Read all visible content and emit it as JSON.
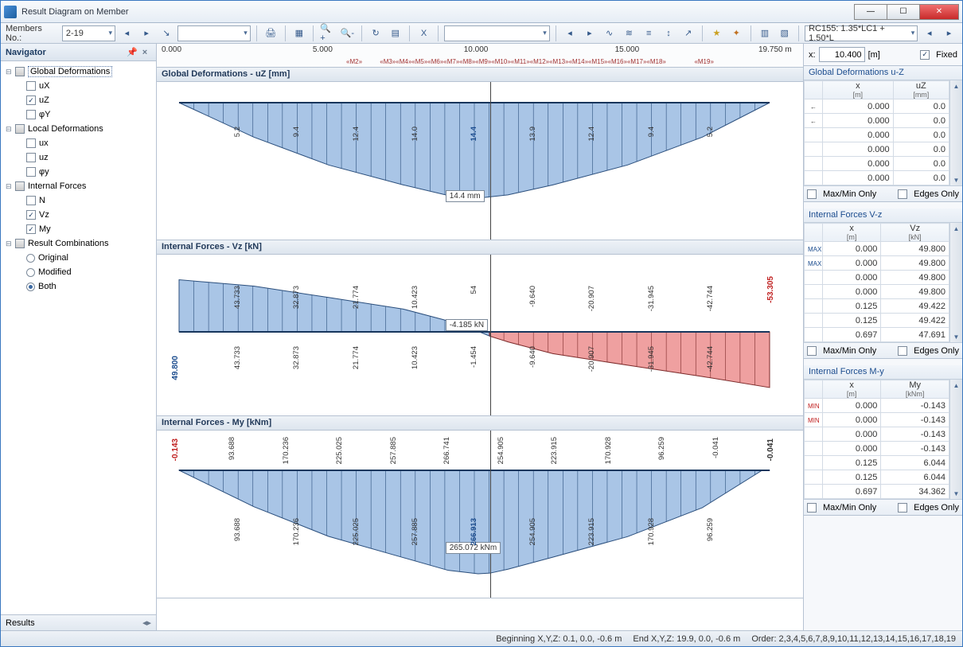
{
  "window": {
    "title": "Result Diagram on Member"
  },
  "toolbar": {
    "members_label": "Members No.:",
    "members_value": "2-19",
    "combo_case": "RC155: 1.35*LC1 + 1.50*L"
  },
  "navigator": {
    "title": "Navigator",
    "groups": [
      {
        "label": "Global Deformations",
        "items": [
          {
            "key": "uX",
            "label": "uX",
            "checked": false
          },
          {
            "key": "uZ",
            "label": "uZ",
            "checked": true
          },
          {
            "key": "phiY",
            "label": "φY",
            "checked": false
          }
        ]
      },
      {
        "label": "Local Deformations",
        "items": [
          {
            "key": "ux",
            "label": "ux",
            "checked": false
          },
          {
            "key": "uz",
            "label": "uz",
            "checked": false
          },
          {
            "key": "phiy",
            "label": "φy",
            "checked": false
          }
        ]
      },
      {
        "label": "Internal Forces",
        "items": [
          {
            "key": "N",
            "label": "N",
            "checked": false
          },
          {
            "key": "Vz",
            "label": "Vz",
            "checked": true
          },
          {
            "key": "My",
            "label": "My",
            "checked": true
          }
        ]
      },
      {
        "label": "Result Combinations",
        "items": [
          {
            "key": "orig",
            "label": "Original",
            "radio": true,
            "checked": false
          },
          {
            "key": "mod",
            "label": "Modified",
            "radio": true,
            "checked": false
          },
          {
            "key": "both",
            "label": "Both",
            "radio": true,
            "checked": true
          }
        ]
      }
    ],
    "footer": "Results"
  },
  "ruler": {
    "ticks": [
      "0.000",
      "5.000",
      "10.000",
      "15.000",
      "19.750 m"
    ],
    "mseries": [
      "M2",
      "M3",
      "M4",
      "M5",
      "M6",
      "M7",
      "M8",
      "M9",
      "M10",
      "M11",
      "M12",
      "M13",
      "M14",
      "M15",
      "M16",
      "M17",
      "M18",
      "M19"
    ]
  },
  "xbox": {
    "label": "x:",
    "value": "10.400",
    "unit": "[m]",
    "fixed_label": "Fixed",
    "fixed": true
  },
  "panels": [
    {
      "title": "Global Deformations - uZ [mm]",
      "tip": "14.4 mm",
      "left_end": "",
      "right_end": "",
      "labels_top": [
        "5.2",
        "9.4",
        "12.4",
        "14.0",
        "14.4",
        "13.9",
        "12.4",
        "9.4",
        "5.2"
      ],
      "labels_top_max": "14.4"
    },
    {
      "title": "Internal Forces - Vz [kN]",
      "tip": "-4.185 kN",
      "left_end": "49.800",
      "right_end": "-53.305",
      "labels_top": [
        "43.733",
        "32.873",
        "21.774",
        "10.423",
        "54",
        "-9.640",
        "-20.907",
        "-31.945",
        "-42.744"
      ],
      "labels_bot": [
        "43.733",
        "32.873",
        "21.774",
        "10.423",
        "-1.454",
        "-9.640",
        "-20.907",
        "-31.945",
        "-42.744"
      ]
    },
    {
      "title": "Internal Forces - My [kNm]",
      "tip": "265.072 kNm",
      "left_end": "-0.143",
      "right_end": "-0.041",
      "labels_top": [
        "93.688",
        "170.236",
        "225.025",
        "257.885",
        "266.741",
        "254.905",
        "223.915",
        "170.928",
        "96.259",
        "-0.041"
      ],
      "labels_bot": [
        "93.688",
        "170.236",
        "225.025",
        "257.885",
        "266.913",
        "254.905",
        "223.915",
        "170.928",
        "96.259"
      ]
    }
  ],
  "grids": [
    {
      "title": "Global Deformations u-Z",
      "hx": "x",
      "hxu": "[m]",
      "hv": "uZ",
      "hvu": "[mm]",
      "rows": [
        {
          "mk": "←",
          "x": "0.000",
          "v": "0.0"
        },
        {
          "mk": "←",
          "x": "0.000",
          "v": "0.0"
        },
        {
          "x": "0.000",
          "v": "0.0"
        },
        {
          "x": "0.000",
          "v": "0.0"
        },
        {
          "x": "0.000",
          "v": "0.0"
        },
        {
          "x": "0.000",
          "v": "0.0"
        }
      ],
      "maxmin": "Max/Min Only",
      "edges": "Edges Only"
    },
    {
      "title": "Internal Forces V-z",
      "hx": "x",
      "hxu": "[m]",
      "hv": "Vz",
      "hvu": "[kN]",
      "rows": [
        {
          "mk": "MAX",
          "mkc": "max",
          "x": "0.000",
          "v": "49.800"
        },
        {
          "mk": "MAX",
          "mkc": "max",
          "x": "0.000",
          "v": "49.800"
        },
        {
          "x": "0.000",
          "v": "49.800"
        },
        {
          "x": "0.000",
          "v": "49.800"
        },
        {
          "x": "0.125",
          "v": "49.422"
        },
        {
          "x": "0.125",
          "v": "49.422"
        },
        {
          "x": "0.697",
          "v": "47.691"
        }
      ],
      "maxmin": "Max/Min Only",
      "edges": "Edges Only"
    },
    {
      "title": "Internal Forces M-y",
      "hx": "x",
      "hxu": "[m]",
      "hv": "My",
      "hvu": "[kNm]",
      "rows": [
        {
          "mk": "MIN",
          "mkc": "min",
          "x": "0.000",
          "v": "-0.143"
        },
        {
          "mk": "MIN",
          "mkc": "min",
          "x": "0.000",
          "v": "-0.143"
        },
        {
          "x": "0.000",
          "v": "-0.143"
        },
        {
          "x": "0.000",
          "v": "-0.143"
        },
        {
          "x": "0.125",
          "v": "6.044"
        },
        {
          "x": "0.125",
          "v": "6.044"
        },
        {
          "x": "0.697",
          "v": "34.362"
        }
      ],
      "maxmin": "Max/Min Only",
      "edges": "Edges Only"
    }
  ],
  "status": {
    "begin": "Beginning X,Y,Z:   0.1, 0.0, -0.6 m",
    "end": "End X,Y,Z:   19.9, 0.0, -0.6 m",
    "order": "Order:   2,3,4,5,6,7,8,9,10,11,12,13,14,15,16,17,18,19"
  },
  "chart_data": [
    {
      "type": "area",
      "title": "Global Deformations - uZ [mm]",
      "xlabel": "x [m]",
      "ylabel": "uZ [mm]",
      "x_range": [
        0,
        19.75
      ],
      "x": [
        0,
        2.5,
        5.0,
        7.5,
        9.0,
        10.0,
        11.0,
        12.5,
        15.0,
        17.5,
        19.75
      ],
      "values": [
        0,
        5.2,
        9.4,
        12.4,
        14.0,
        14.4,
        13.9,
        12.4,
        9.4,
        5.2,
        0
      ],
      "cursor_x": 10.4,
      "cursor_value": 14.4
    },
    {
      "type": "area",
      "title": "Internal Forces - Vz [kN]",
      "xlabel": "x [m]",
      "ylabel": "Vz [kN]",
      "x_range": [
        0,
        19.75
      ],
      "x": [
        0,
        2.5,
        5.0,
        7.5,
        9.0,
        10.0,
        10.4,
        11.0,
        12.5,
        15.0,
        17.5,
        19.75
      ],
      "values": [
        49.8,
        43.733,
        32.873,
        21.774,
        10.423,
        0.54,
        -4.185,
        -9.64,
        -20.907,
        -31.945,
        -42.744,
        -53.305
      ],
      "cursor_x": 10.4,
      "cursor_value": -4.185
    },
    {
      "type": "area",
      "title": "Internal Forces - My [kNm]",
      "xlabel": "x [m]",
      "ylabel": "My [kNm]",
      "x_range": [
        0,
        19.75
      ],
      "x": [
        0,
        2.5,
        5.0,
        7.5,
        9.0,
        10.0,
        10.4,
        11.0,
        12.5,
        15.0,
        17.5,
        19.5,
        19.75
      ],
      "values": [
        -0.143,
        93.688,
        170.236,
        225.025,
        257.885,
        266.741,
        265.072,
        254.905,
        223.915,
        170.928,
        96.259,
        -0.041,
        -0.041
      ],
      "cursor_x": 10.4,
      "cursor_value": 265.072
    }
  ]
}
